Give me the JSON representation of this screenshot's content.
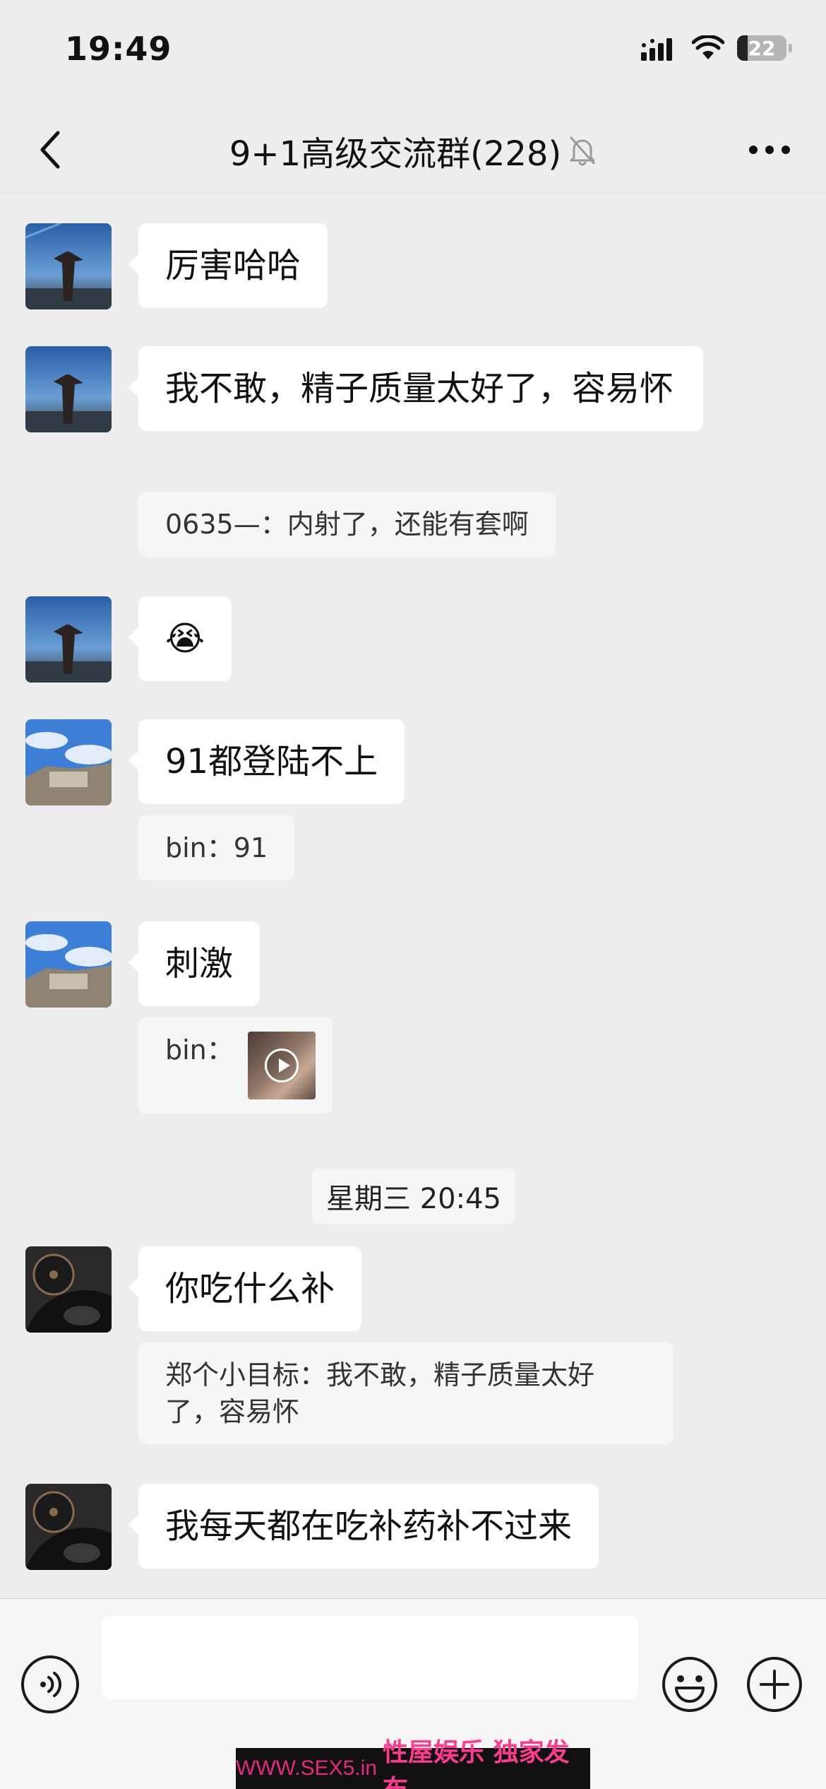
{
  "status_bar": {
    "time": "19:49",
    "battery": "22",
    "battery_level_fraction": 0.22
  },
  "nav": {
    "title": "9+1高级交流群(228)",
    "back_icon": "chevron-left-icon",
    "mute_icon": "muted-bell-icon",
    "more_icon": "more-dots-icon"
  },
  "messages": [
    {
      "avatar": "avatar-dusk-statue",
      "text": "厉害哈哈"
    },
    {
      "avatar": "avatar-dusk-statue",
      "text": "我不敢，精子质量太好了，容易怀",
      "quote": "0635—：内射了，还能有套啊"
    },
    {
      "avatar": "avatar-dusk-statue",
      "text": "😭"
    },
    {
      "avatar": "avatar-palace",
      "text": "91都登陆不上",
      "quote": "bin：91"
    },
    {
      "avatar": "avatar-palace",
      "text": "刺激",
      "quote": "bin：",
      "quote_thumb": "video-thumbnail"
    }
  ],
  "time_divider": "星期三 20:45",
  "messages_after": [
    {
      "avatar": "avatar-car-dashboard",
      "text": "你吃什么补",
      "quote": "郑个小目标：我不敢，精子质量太好了，容易怀"
    },
    {
      "avatar": "avatar-car-dashboard",
      "text": "我每天都在吃补药补不过来"
    }
  ],
  "input_bar": {
    "voice_icon": "voice-icon",
    "emoji_icon": "emoji-icon",
    "plus_icon": "plus-icon",
    "input_value": ""
  },
  "watermark": {
    "url": "WWW.SEX5.in",
    "text": "性屋娱乐 独家发布"
  }
}
